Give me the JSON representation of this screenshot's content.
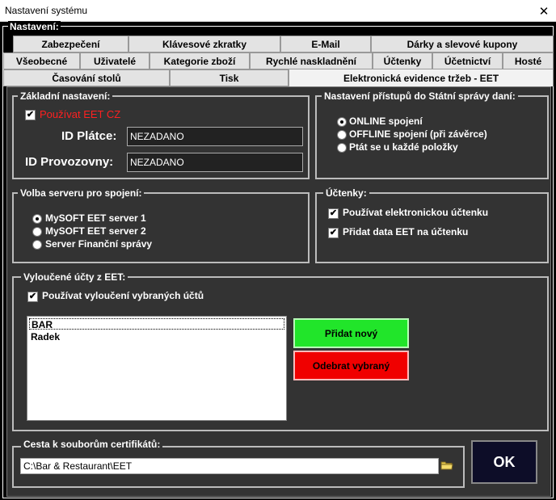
{
  "window": {
    "title": "Nastavení systému",
    "close_glyph": "✕"
  },
  "settings_group": {
    "legend": "Nastavení:"
  },
  "tabs": {
    "row1": [
      "Zabezpečení",
      "Klávesové zkratky",
      "E-Mail",
      "Dárky a slevové kupony"
    ],
    "row2": [
      "Všeobecné",
      "Uživatelé",
      "Kategorie zboží",
      "Rychlé naskladnění",
      "Účtenky",
      "Účetnictví",
      "Hosté"
    ],
    "row3": [
      "Časování stolů",
      "Tisk",
      "Elektronická evidence tržeb - EET"
    ],
    "active": "Elektronická evidence tržeb - EET"
  },
  "basic": {
    "legend": "Základní nastavení:",
    "use_eet_label": "Používat EET CZ",
    "use_eet_checked": true,
    "id_platce_label": "ID Plátce:",
    "id_platce_value": "NEZADANO",
    "id_provozovny_label": "ID Provozovny:",
    "id_provozovny_value": "NEZADANO"
  },
  "access": {
    "legend": "Nastavení přístupů do Státní správy daní:",
    "options": [
      "ONLINE spojení",
      "OFFLINE spojení (při závěrce)",
      "Ptát se u každé položky"
    ],
    "selected": 0
  },
  "server": {
    "legend": "Volba serveru pro spojení:",
    "options": [
      "MySOFT EET server 1",
      "MySOFT EET server 2",
      "Server Finanční správy"
    ],
    "selected": 0
  },
  "receipts": {
    "legend": "Účtenky:",
    "use_electronic_label": "Používat elektronickou účtenku",
    "use_electronic_checked": true,
    "add_eet_label": "Přidat data EET na účtenku",
    "add_eet_checked": true
  },
  "excluded": {
    "legend": "Vyloučené účty z EET:",
    "use_exclusion_label": "Používat vyloučení vybraných účtů",
    "use_exclusion_checked": true,
    "accounts": [
      "BAR",
      "Radek"
    ],
    "add_button": "Přidat nový",
    "remove_button": "Odebrat vybraný"
  },
  "certificates": {
    "legend": "Cesta k souborům certifikátů:",
    "path": "C:\\Bar & Restaurant\\EET"
  },
  "ok_button": "OK",
  "colors": {
    "panel": "#333333",
    "use_eet_text": "#ff2020",
    "add_button": "#21e52a",
    "remove_button": "#f00000",
    "ok_button": "#0d0d28"
  }
}
